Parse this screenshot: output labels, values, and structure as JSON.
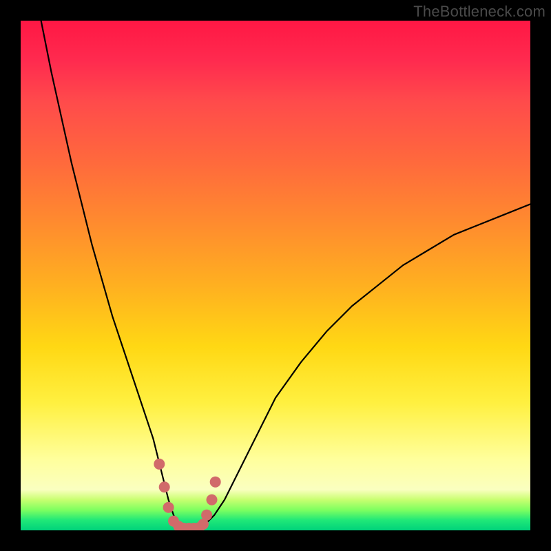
{
  "watermark": "TheBottleneck.com",
  "colors": {
    "frame": "#000000",
    "curve": "#000000",
    "markers": "#d16a6a",
    "gradient_top": "#ff1744",
    "gradient_bottom": "#00d27a"
  },
  "chart_data": {
    "type": "line",
    "title": "",
    "xlabel": "",
    "ylabel": "",
    "xlim": [
      0,
      100
    ],
    "ylim": [
      0,
      100
    ],
    "grid": false,
    "legend": false,
    "annotations": [
      "TheBottleneck.com"
    ],
    "series": [
      {
        "name": "bottleneck-curve",
        "x": [
          4,
          6,
          8,
          10,
          12,
          14,
          16,
          18,
          20,
          22,
          24,
          26,
          27,
          28,
          29,
          30,
          31,
          32,
          33,
          34,
          35,
          36,
          38,
          40,
          42,
          44,
          46,
          48,
          50,
          55,
          60,
          65,
          70,
          75,
          80,
          85,
          90,
          95,
          100
        ],
        "y": [
          100,
          90,
          81,
          72,
          64,
          56,
          49,
          42,
          36,
          30,
          24,
          18,
          14,
          10,
          6,
          3,
          1,
          0,
          0,
          0,
          0,
          1,
          3,
          6,
          10,
          14,
          18,
          22,
          26,
          33,
          39,
          44,
          48,
          52,
          55,
          58,
          60,
          62,
          64
        ]
      }
    ],
    "markers": {
      "name": "highlight-points",
      "color": "#d16a6a",
      "x": [
        27.2,
        28.2,
        29.0,
        30.0,
        31.0,
        32.0,
        33.0,
        34.0,
        35.0,
        35.8,
        36.5,
        37.5,
        38.2
      ],
      "y": [
        13.0,
        8.5,
        4.5,
        1.8,
        0.8,
        0.4,
        0.4,
        0.4,
        0.5,
        1.2,
        3.0,
        6.0,
        9.5
      ]
    }
  }
}
